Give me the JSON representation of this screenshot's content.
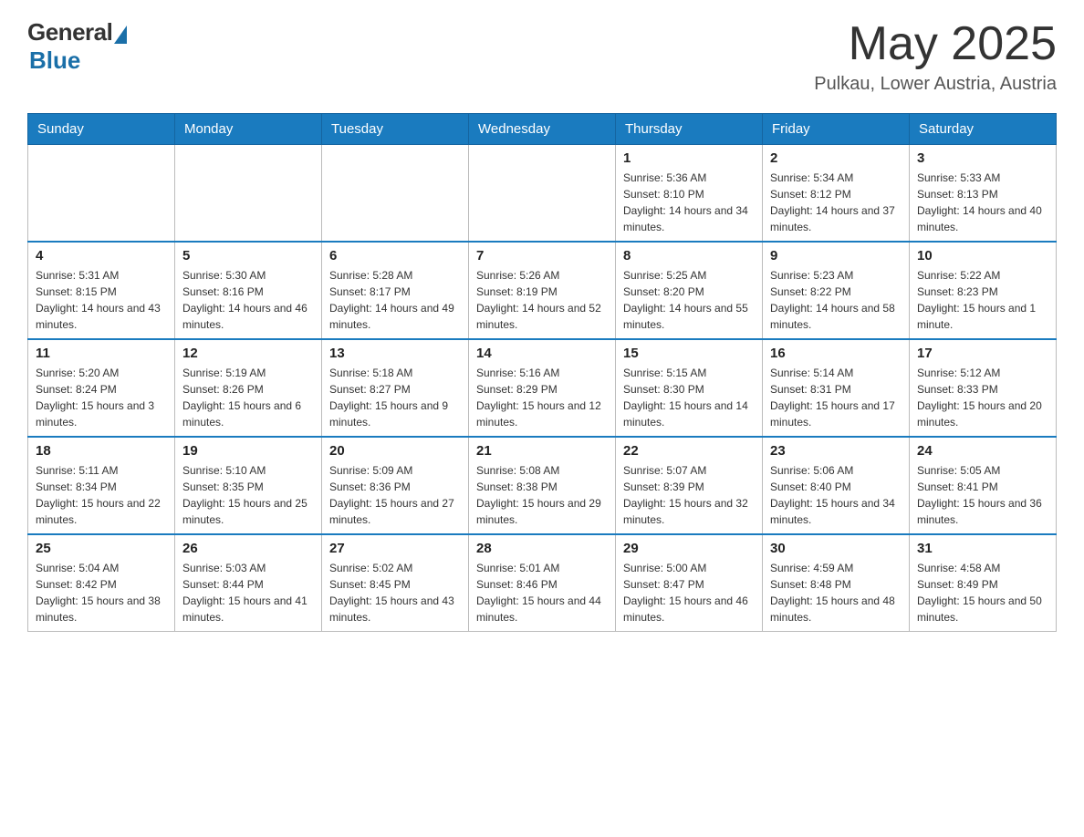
{
  "header": {
    "logo": {
      "general": "General",
      "blue": "Blue"
    },
    "title": "May 2025",
    "location": "Pulkau, Lower Austria, Austria"
  },
  "days_of_week": [
    "Sunday",
    "Monday",
    "Tuesday",
    "Wednesday",
    "Thursday",
    "Friday",
    "Saturday"
  ],
  "weeks": [
    [
      {
        "day": "",
        "info": ""
      },
      {
        "day": "",
        "info": ""
      },
      {
        "day": "",
        "info": ""
      },
      {
        "day": "",
        "info": ""
      },
      {
        "day": "1",
        "info": "Sunrise: 5:36 AM\nSunset: 8:10 PM\nDaylight: 14 hours and 34 minutes."
      },
      {
        "day": "2",
        "info": "Sunrise: 5:34 AM\nSunset: 8:12 PM\nDaylight: 14 hours and 37 minutes."
      },
      {
        "day": "3",
        "info": "Sunrise: 5:33 AM\nSunset: 8:13 PM\nDaylight: 14 hours and 40 minutes."
      }
    ],
    [
      {
        "day": "4",
        "info": "Sunrise: 5:31 AM\nSunset: 8:15 PM\nDaylight: 14 hours and 43 minutes."
      },
      {
        "day": "5",
        "info": "Sunrise: 5:30 AM\nSunset: 8:16 PM\nDaylight: 14 hours and 46 minutes."
      },
      {
        "day": "6",
        "info": "Sunrise: 5:28 AM\nSunset: 8:17 PM\nDaylight: 14 hours and 49 minutes."
      },
      {
        "day": "7",
        "info": "Sunrise: 5:26 AM\nSunset: 8:19 PM\nDaylight: 14 hours and 52 minutes."
      },
      {
        "day": "8",
        "info": "Sunrise: 5:25 AM\nSunset: 8:20 PM\nDaylight: 14 hours and 55 minutes."
      },
      {
        "day": "9",
        "info": "Sunrise: 5:23 AM\nSunset: 8:22 PM\nDaylight: 14 hours and 58 minutes."
      },
      {
        "day": "10",
        "info": "Sunrise: 5:22 AM\nSunset: 8:23 PM\nDaylight: 15 hours and 1 minute."
      }
    ],
    [
      {
        "day": "11",
        "info": "Sunrise: 5:20 AM\nSunset: 8:24 PM\nDaylight: 15 hours and 3 minutes."
      },
      {
        "day": "12",
        "info": "Sunrise: 5:19 AM\nSunset: 8:26 PM\nDaylight: 15 hours and 6 minutes."
      },
      {
        "day": "13",
        "info": "Sunrise: 5:18 AM\nSunset: 8:27 PM\nDaylight: 15 hours and 9 minutes."
      },
      {
        "day": "14",
        "info": "Sunrise: 5:16 AM\nSunset: 8:29 PM\nDaylight: 15 hours and 12 minutes."
      },
      {
        "day": "15",
        "info": "Sunrise: 5:15 AM\nSunset: 8:30 PM\nDaylight: 15 hours and 14 minutes."
      },
      {
        "day": "16",
        "info": "Sunrise: 5:14 AM\nSunset: 8:31 PM\nDaylight: 15 hours and 17 minutes."
      },
      {
        "day": "17",
        "info": "Sunrise: 5:12 AM\nSunset: 8:33 PM\nDaylight: 15 hours and 20 minutes."
      }
    ],
    [
      {
        "day": "18",
        "info": "Sunrise: 5:11 AM\nSunset: 8:34 PM\nDaylight: 15 hours and 22 minutes."
      },
      {
        "day": "19",
        "info": "Sunrise: 5:10 AM\nSunset: 8:35 PM\nDaylight: 15 hours and 25 minutes."
      },
      {
        "day": "20",
        "info": "Sunrise: 5:09 AM\nSunset: 8:36 PM\nDaylight: 15 hours and 27 minutes."
      },
      {
        "day": "21",
        "info": "Sunrise: 5:08 AM\nSunset: 8:38 PM\nDaylight: 15 hours and 29 minutes."
      },
      {
        "day": "22",
        "info": "Sunrise: 5:07 AM\nSunset: 8:39 PM\nDaylight: 15 hours and 32 minutes."
      },
      {
        "day": "23",
        "info": "Sunrise: 5:06 AM\nSunset: 8:40 PM\nDaylight: 15 hours and 34 minutes."
      },
      {
        "day": "24",
        "info": "Sunrise: 5:05 AM\nSunset: 8:41 PM\nDaylight: 15 hours and 36 minutes."
      }
    ],
    [
      {
        "day": "25",
        "info": "Sunrise: 5:04 AM\nSunset: 8:42 PM\nDaylight: 15 hours and 38 minutes."
      },
      {
        "day": "26",
        "info": "Sunrise: 5:03 AM\nSunset: 8:44 PM\nDaylight: 15 hours and 41 minutes."
      },
      {
        "day": "27",
        "info": "Sunrise: 5:02 AM\nSunset: 8:45 PM\nDaylight: 15 hours and 43 minutes."
      },
      {
        "day": "28",
        "info": "Sunrise: 5:01 AM\nSunset: 8:46 PM\nDaylight: 15 hours and 44 minutes."
      },
      {
        "day": "29",
        "info": "Sunrise: 5:00 AM\nSunset: 8:47 PM\nDaylight: 15 hours and 46 minutes."
      },
      {
        "day": "30",
        "info": "Sunrise: 4:59 AM\nSunset: 8:48 PM\nDaylight: 15 hours and 48 minutes."
      },
      {
        "day": "31",
        "info": "Sunrise: 4:58 AM\nSunset: 8:49 PM\nDaylight: 15 hours and 50 minutes."
      }
    ]
  ]
}
